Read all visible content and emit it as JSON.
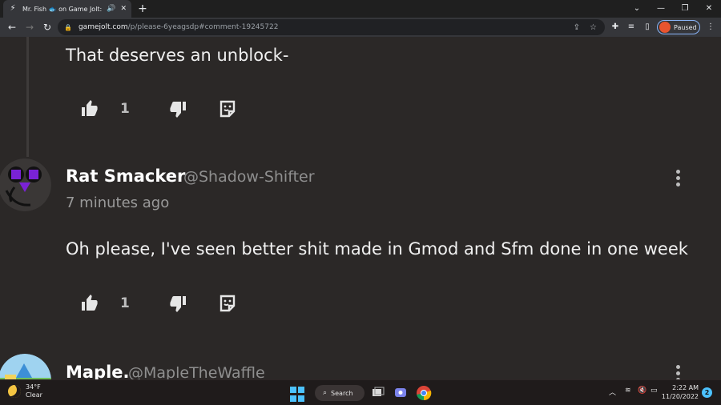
{
  "browser": {
    "tab_title": "Mr. Fish 🐟 on Game Jolt: \"P",
    "new_tab": "+",
    "url_host": "gamejolt.com",
    "url_path": "/p/please-6yeagsdp#comment-19245722",
    "profile_status": "Paused",
    "icons": [
      "gamejolt-favicon",
      "speaker-icon",
      "close-tab-icon",
      "back-icon",
      "forward-icon",
      "reload-icon",
      "lock-icon",
      "share-icon",
      "bookmark-star-icon",
      "extensions-icon",
      "reading-list-icon",
      "side-panel-icon",
      "menu-icon"
    ]
  },
  "comments": [
    {
      "text": "That deserves an unblock-",
      "likes": "1"
    },
    {
      "username": "Rat Smacker",
      "handle": "@Shadow-Shifter",
      "timestamp": "7 minutes ago",
      "text": "Oh please, I've seen better shit made in Gmod and Sfm done in one week",
      "likes": "1"
    },
    {
      "username": "Maple.",
      "handle": "@MapleTheWaffle"
    }
  ],
  "taskbar": {
    "weather_temp": "34°F",
    "weather_desc": "Clear",
    "search_label": "Search",
    "time": "2:22 AM",
    "date": "11/20/2022",
    "notifications": "2",
    "accent": "#4cc2ff"
  },
  "colors": {
    "page_bg": "#2b2827",
    "text": "#f0f0f0",
    "muted": "#8f8f8f",
    "avatar_purple": "#7a22d6"
  }
}
